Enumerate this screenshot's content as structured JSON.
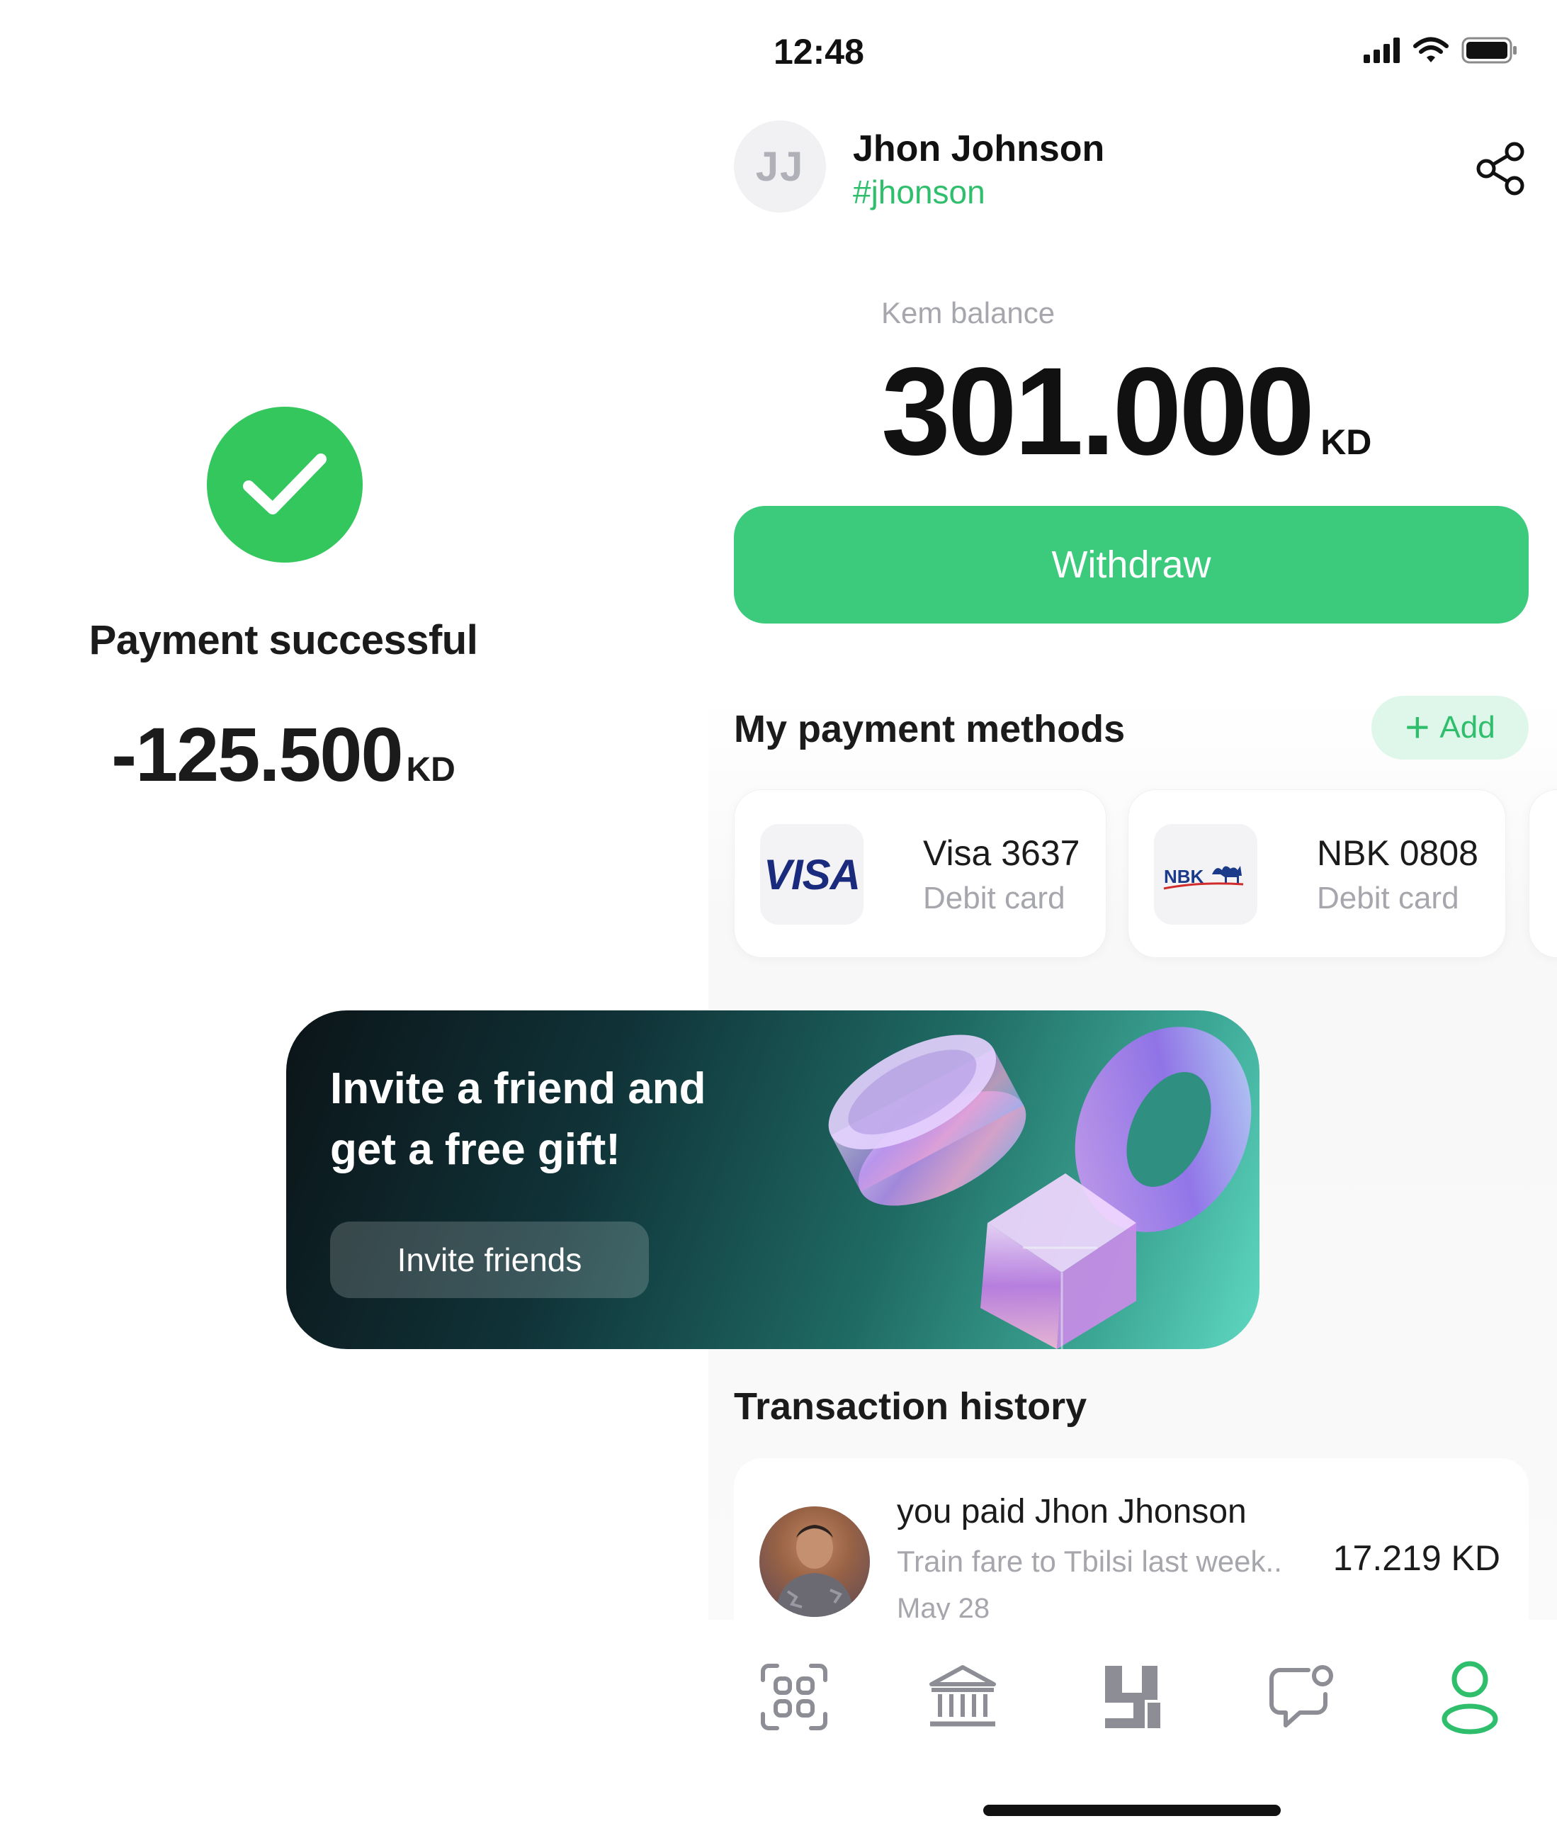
{
  "status_bar": {
    "time": "12:48"
  },
  "profile": {
    "initials": "JJ",
    "name": "Jhon Johnson",
    "handle": "#jhonson"
  },
  "balance": {
    "label": "Kem balance",
    "amount": "301.000",
    "currency": "KD"
  },
  "withdraw": {
    "label": "Withdraw"
  },
  "payment_methods": {
    "title": "My payment methods",
    "add_label": "Add",
    "cards": [
      {
        "logo": "VISA",
        "name": "Visa 3637",
        "type": "Debit card"
      },
      {
        "logo": "NBK",
        "name": "NBK 0808",
        "type": "Debit card"
      }
    ]
  },
  "success": {
    "title": "Payment successful",
    "amount": "-125.500",
    "currency": "KD"
  },
  "banner": {
    "line1": "Invite a friend and",
    "line2": "get a free gift!",
    "button": "Invite friends"
  },
  "transactions": {
    "title": "Transaction history",
    "items": [
      {
        "title": "you paid Jhon Jhonson",
        "note": "Train fare to Tbilsi last week..",
        "date": "May 28",
        "amount": "17.219 KD"
      }
    ]
  },
  "tabbar": {
    "items": [
      "scan-icon",
      "bank-icon",
      "app-logo-icon",
      "chat-icon",
      "profile-icon"
    ],
    "active": "profile-icon"
  },
  "colors": {
    "accent": "#3cca7d",
    "accent_text": "#2fbf6c",
    "success": "#34c75e",
    "muted": "#a6a6ad"
  }
}
